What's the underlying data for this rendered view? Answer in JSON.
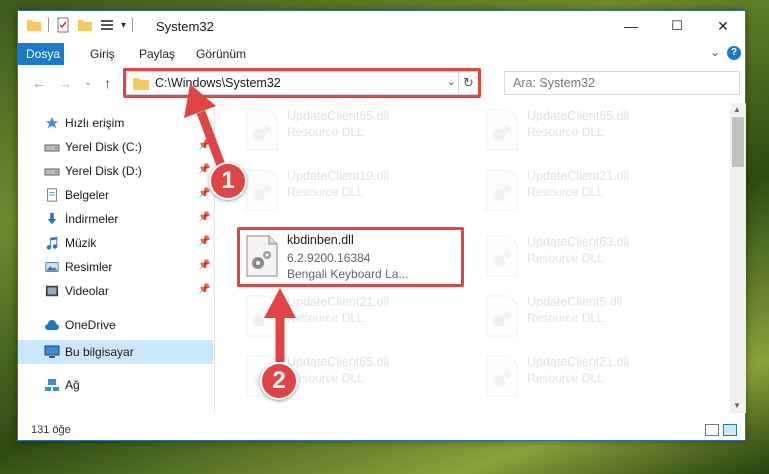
{
  "window": {
    "title": "System32",
    "controls": {
      "minimize": "—",
      "maximize": "☐",
      "close": "✕"
    }
  },
  "ribbon": {
    "tabs": [
      {
        "label": "Dosya",
        "active": true
      },
      {
        "label": "Giriş"
      },
      {
        "label": "Paylaş"
      },
      {
        "label": "Görünüm"
      }
    ],
    "expand": "⌄",
    "help": "?"
  },
  "nav": {
    "back": "←",
    "forward": "→",
    "recent": "⌄",
    "up": "↑"
  },
  "address": {
    "path": "C:\\Windows\\System32",
    "dropdown": "⌄",
    "refresh": "↻"
  },
  "search": {
    "placeholder": "Ara: System32"
  },
  "sidebar": {
    "items": [
      {
        "label": "Hızlı erişim",
        "icon": "star-icon",
        "pinned": false
      },
      {
        "label": "Yerel Disk (C:)",
        "icon": "drive-icon",
        "pinned": true
      },
      {
        "label": "Yerel Disk (D:)",
        "icon": "drive-icon",
        "pinned": true
      },
      {
        "label": "Belgeler",
        "icon": "document-icon",
        "pinned": true
      },
      {
        "label": "İndirmeler",
        "icon": "download-icon",
        "pinned": true
      },
      {
        "label": "Müzik",
        "icon": "music-icon",
        "pinned": true
      },
      {
        "label": "Resimler",
        "icon": "pictures-icon",
        "pinned": true
      },
      {
        "label": "Videolar",
        "icon": "video-icon",
        "pinned": true
      },
      {
        "label": "OneDrive",
        "icon": "cloud-icon",
        "pinned": false
      },
      {
        "label": "Bu bilgisayar",
        "icon": "computer-icon",
        "pinned": false,
        "selected": true
      },
      {
        "label": "Ağ",
        "icon": "network-icon",
        "pinned": false
      }
    ]
  },
  "files": [
    {
      "name": "UpdateClient65.dll",
      "desc": "Resource DLL",
      "dim": true
    },
    {
      "name": "UpdateClient65.dll",
      "desc": "Resource DLL",
      "dim": true
    },
    {
      "name": "UpdateClient19.dll",
      "desc": "Resource DLL",
      "dim": true
    },
    {
      "name": "UpdateClient21.dll",
      "desc": "Resource DLL",
      "dim": true
    },
    {
      "name": "kbdinben.dll",
      "version": "6.2.9200.16384",
      "desc": "Bengali Keyboard La...",
      "dim": false
    },
    {
      "name": "UpdateClient63.dll",
      "desc": "Resource DLL",
      "dim": true
    },
    {
      "name": "UpdateClient21.dll",
      "desc": "Resource DLL",
      "dim": true
    },
    {
      "name": "UpdateClient5.dll",
      "desc": "Resource DLL",
      "dim": true
    },
    {
      "name": "UpdateClient65.dll",
      "desc": "Resource DLL",
      "dim": true
    },
    {
      "name": "UpdateClient21.dll",
      "desc": "Resource DLL",
      "dim": true
    }
  ],
  "status": {
    "count": "131 öğe"
  },
  "annotations": [
    {
      "number": "1",
      "color": "#e04545"
    },
    {
      "number": "2",
      "color": "#e04545"
    }
  ],
  "colors": {
    "accent": "#1979ca",
    "highlight": "#e04545",
    "selected": "#cce8ff"
  }
}
